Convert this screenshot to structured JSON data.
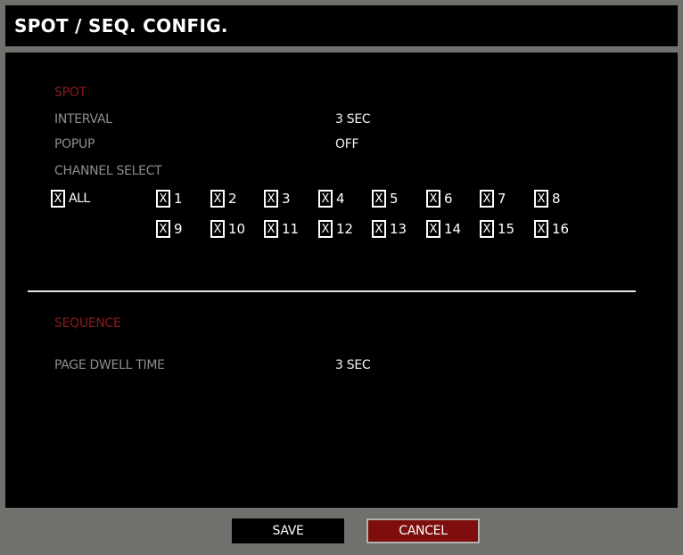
{
  "title": "SPOT / SEQ. CONFIG.",
  "spot": {
    "section_label": "SPOT",
    "interval_label": "INTERVAL",
    "interval_value": "3 SEC",
    "popup_label": "POPUP",
    "popup_value": "OFF",
    "channel_select_label": "CHANNEL SELECT",
    "all_label": "ALL",
    "check_mark": "X",
    "channels": [
      "1",
      "2",
      "3",
      "4",
      "5",
      "6",
      "7",
      "8",
      "9",
      "10",
      "11",
      "12",
      "13",
      "14",
      "15",
      "16"
    ]
  },
  "sequence": {
    "section_label": "SEQUENCE",
    "page_dwell_label": "PAGE DWELL TIME",
    "page_dwell_value": "3 SEC"
  },
  "buttons": {
    "save": "SAVE",
    "cancel": "CANCEL"
  },
  "colors": {
    "background": "#000000",
    "frame": "#6f716c",
    "section_label": "#8b1a1a",
    "cancel_button": "#7e0d0d"
  }
}
